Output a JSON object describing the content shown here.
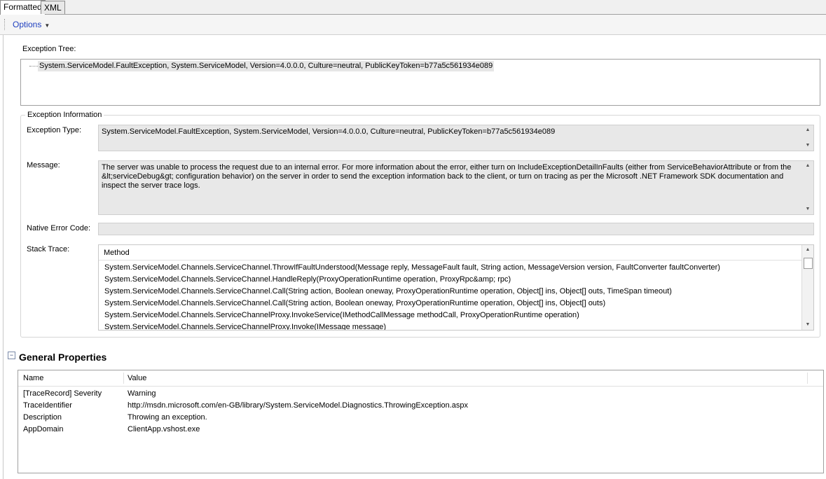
{
  "tabs": [
    "Formatted",
    "XML"
  ],
  "toolbar": {
    "options_label": "Options"
  },
  "exception_tree": {
    "label": "Exception Tree:",
    "item": "System.ServiceModel.FaultException, System.ServiceModel, Version=4.0.0.0, Culture=neutral, PublicKeyToken=b77a5c561934e089"
  },
  "exception_info": {
    "group_title": "Exception Information",
    "type_label": "Exception Type:",
    "type_value": "System.ServiceModel.FaultException, System.ServiceModel, Version=4.0.0.0, Culture=neutral, PublicKeyToken=b77a5c561934e089",
    "message_label": "Message:",
    "message_value": "The server was unable to process the request due to an internal error.  For more information about the error, either turn on IncludeExceptionDetailInFaults (either from ServiceBehaviorAttribute or from the &lt;serviceDebug&gt; configuration behavior) on the server in order to send the exception information back to the client, or turn on tracing as per the Microsoft .NET Framework SDK documentation and inspect the server trace logs.",
    "native_label": "Native Error Code:",
    "native_value": "",
    "stack_label": "Stack Trace:",
    "stack_header": "Method",
    "stack_rows": [
      "System.ServiceModel.Channels.ServiceChannel.ThrowIfFaultUnderstood(Message reply, MessageFault fault, String action, MessageVersion version, FaultConverter faultConverter)",
      "System.ServiceModel.Channels.ServiceChannel.HandleReply(ProxyOperationRuntime operation, ProxyRpc&amp; rpc)",
      "System.ServiceModel.Channels.ServiceChannel.Call(String action, Boolean oneway, ProxyOperationRuntime operation, Object[] ins, Object[] outs, TimeSpan timeout)",
      "System.ServiceModel.Channels.ServiceChannel.Call(String action, Boolean oneway, ProxyOperationRuntime operation, Object[] ins, Object[] outs)",
      "System.ServiceModel.Channels.ServiceChannelProxy.InvokeService(IMethodCallMessage methodCall, ProxyOperationRuntime operation)",
      "System.ServiceModel.Channels.ServiceChannelProxy.Invoke(IMessage message)"
    ]
  },
  "general_properties": {
    "title": "General Properties",
    "collapse_symbol": "−",
    "columns": [
      "Name",
      "Value"
    ],
    "rows": [
      {
        "name": "[TraceRecord] Severity",
        "value": "Warning"
      },
      {
        "name": "TraceIdentifier",
        "value": "http://msdn.microsoft.com/en-GB/library/System.ServiceModel.Diagnostics.ThrowingException.aspx"
      },
      {
        "name": "Description",
        "value": "Throwing an exception."
      },
      {
        "name": "AppDomain",
        "value": "ClientApp.vshost.exe"
      }
    ]
  },
  "icons": {
    "dropdown": "chevron-down-icon",
    "scroll_up": "scroll-up-arrow-icon",
    "scroll_down": "scroll-down-arrow-icon",
    "collapse": "collapse-minus-icon"
  }
}
